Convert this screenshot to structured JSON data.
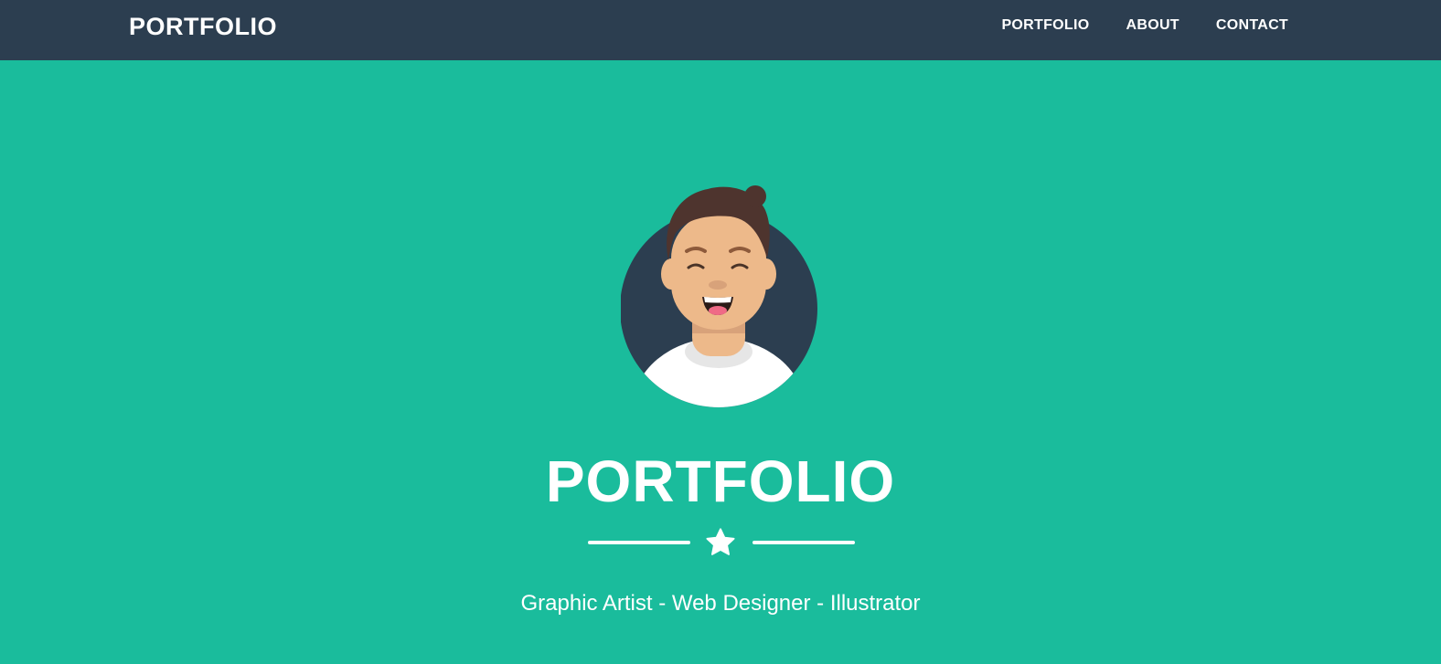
{
  "navbar": {
    "brand": "PORTFOLIO",
    "links": [
      "PORTFOLIO",
      "ABOUT",
      "CONTACT"
    ]
  },
  "hero": {
    "avatar_icon": "smiling-man-avatar",
    "title": "PORTFOLIO",
    "divider_icon": "star-icon",
    "subheading": "Graphic Artist - Web Designer - Illustrator"
  },
  "colors": {
    "navbar_bg": "#2c3e50",
    "hero_bg": "#1abc9c",
    "text": "#ffffff",
    "avatar_bg": "#2c3e50",
    "skin": "#edb98a",
    "hair": "#4e342e"
  }
}
